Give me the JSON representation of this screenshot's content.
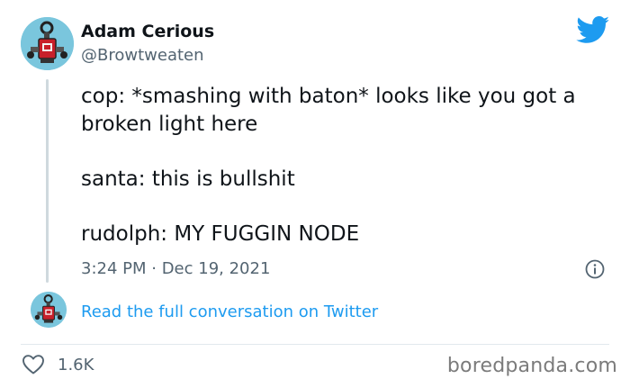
{
  "author": {
    "name": "Adam Cerious",
    "handle": "@Browtweaten"
  },
  "icons": {
    "brand": "twitter-bird-icon",
    "info": "info-icon",
    "like": "heart-icon"
  },
  "colors": {
    "twitter_blue": "#1d9bf0",
    "avatar_bg": "#7ac6dd",
    "secondary_text": "#536471"
  },
  "tweet": {
    "lines": [
      "cop: *smashing with baton* looks like you got a broken light here",
      "santa: this is bullshit",
      "rudolph: MY FUGGIN NODE"
    ],
    "timestamp": "3:24 PM · Dec 19, 2021"
  },
  "read_link": "Read the full conversation on Twitter",
  "likes": "1.6K",
  "watermark": "boredpanda.com"
}
